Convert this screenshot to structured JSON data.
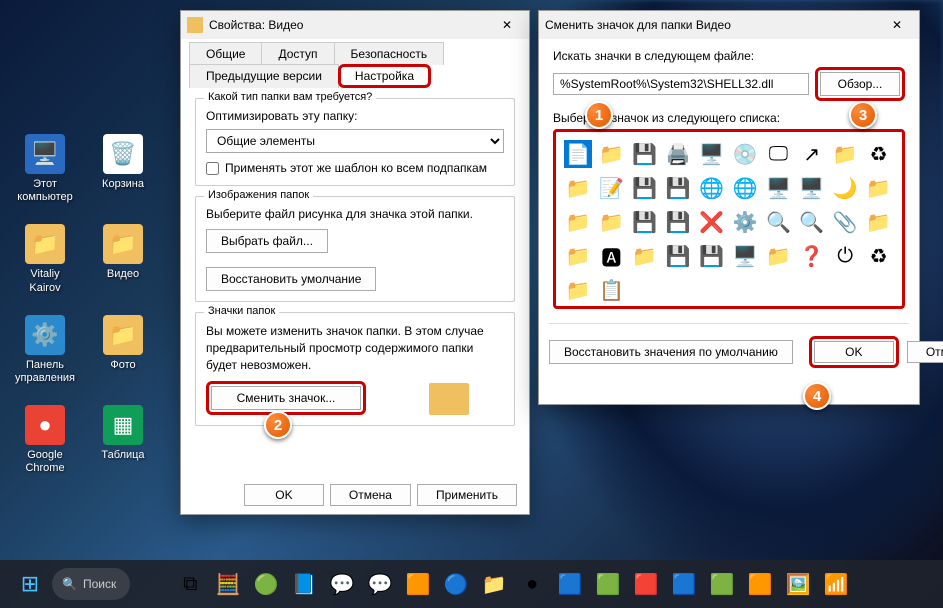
{
  "desktop_icons": [
    {
      "label": "Этот компьютер",
      "glyph": "🖥️",
      "bg": "#2a6ac0"
    },
    {
      "label": "Корзина",
      "glyph": "🗑️",
      "bg": "#fff"
    },
    {
      "label": "Vitaliy Kairov",
      "glyph": "📁",
      "bg": "#f0c060"
    },
    {
      "label": "Видео",
      "glyph": "📁",
      "bg": "#f0c060"
    },
    {
      "label": "Панель управления",
      "glyph": "⚙️",
      "bg": "#2a8acc"
    },
    {
      "label": "Фото",
      "glyph": "📁",
      "bg": "#f0c060"
    },
    {
      "label": "Google Chrome",
      "glyph": "●",
      "bg": "#ea4335"
    },
    {
      "label": "Таблица",
      "glyph": "▦",
      "bg": "#0f9d58"
    }
  ],
  "win1": {
    "title": "Свойства: Видео",
    "tabs": [
      "Общие",
      "Доступ",
      "Безопасность",
      "Предыдущие версии",
      "Настройка"
    ],
    "active_tab": "Настройка",
    "g1_label": "Какой тип папки вам требуется?",
    "opt_label": "Оптимизировать эту папку:",
    "opt_value": "Общие элементы",
    "chk_label": "Применять этот же шаблон ко всем подпапкам",
    "g2_label": "Изображения папок",
    "g2_text": "Выберите файл рисунка для значка этой папки.",
    "choose_file": "Выбрать файл...",
    "restore_def": "Восстановить умолчание",
    "g3_label": "Значки папок",
    "g3_text": "Вы можете изменить значок папки. В этом случае предварительный просмотр содержимого папки будет невозможен.",
    "change_icon": "Сменить значок...",
    "ok": "OK",
    "cancel": "Отмена",
    "apply": "Применить"
  },
  "win2": {
    "title": "Сменить значок для папки Видео",
    "search_label": "Искать значки в следующем файле:",
    "path": "%SystemRoot%\\System32\\SHELL32.dll",
    "browse": "Обзор...",
    "pick_label": "Выберите значок из следующего списка:",
    "restore": "Восстановить значения по умолчанию",
    "ok": "OK",
    "cancel": "Отмена",
    "icons": [
      "📄",
      "📁",
      "💾",
      "🖨️",
      "🖥️",
      "💿",
      "🖵",
      "↗",
      "📁",
      "♻",
      "📁",
      "📝",
      "💾",
      "💾",
      "🌐",
      "🌐",
      "🖥️",
      "🖥️",
      "🌙",
      "📁",
      "📁",
      "📁",
      "💾",
      "💾",
      "❌",
      "⚙️",
      "🔍",
      "🔍",
      "📎",
      "📁",
      "📁",
      "🅰",
      "📁",
      "💾",
      "💾",
      "🖥️",
      "📁",
      "❓",
      "⏻",
      "♻",
      "📁",
      "📋"
    ]
  },
  "taskbar": {
    "search": "Поиск",
    "items": [
      "⊞",
      "",
      "⧉",
      "🧮",
      "🟢",
      "📘",
      "💬",
      "💬",
      "🟧",
      "🔵",
      "📁",
      "●",
      "🟦",
      "🟩",
      "🟥",
      "🟦",
      "🟩",
      "🟧",
      "🖼️",
      "📶"
    ]
  },
  "markers": [
    "1",
    "2",
    "3",
    "4"
  ]
}
